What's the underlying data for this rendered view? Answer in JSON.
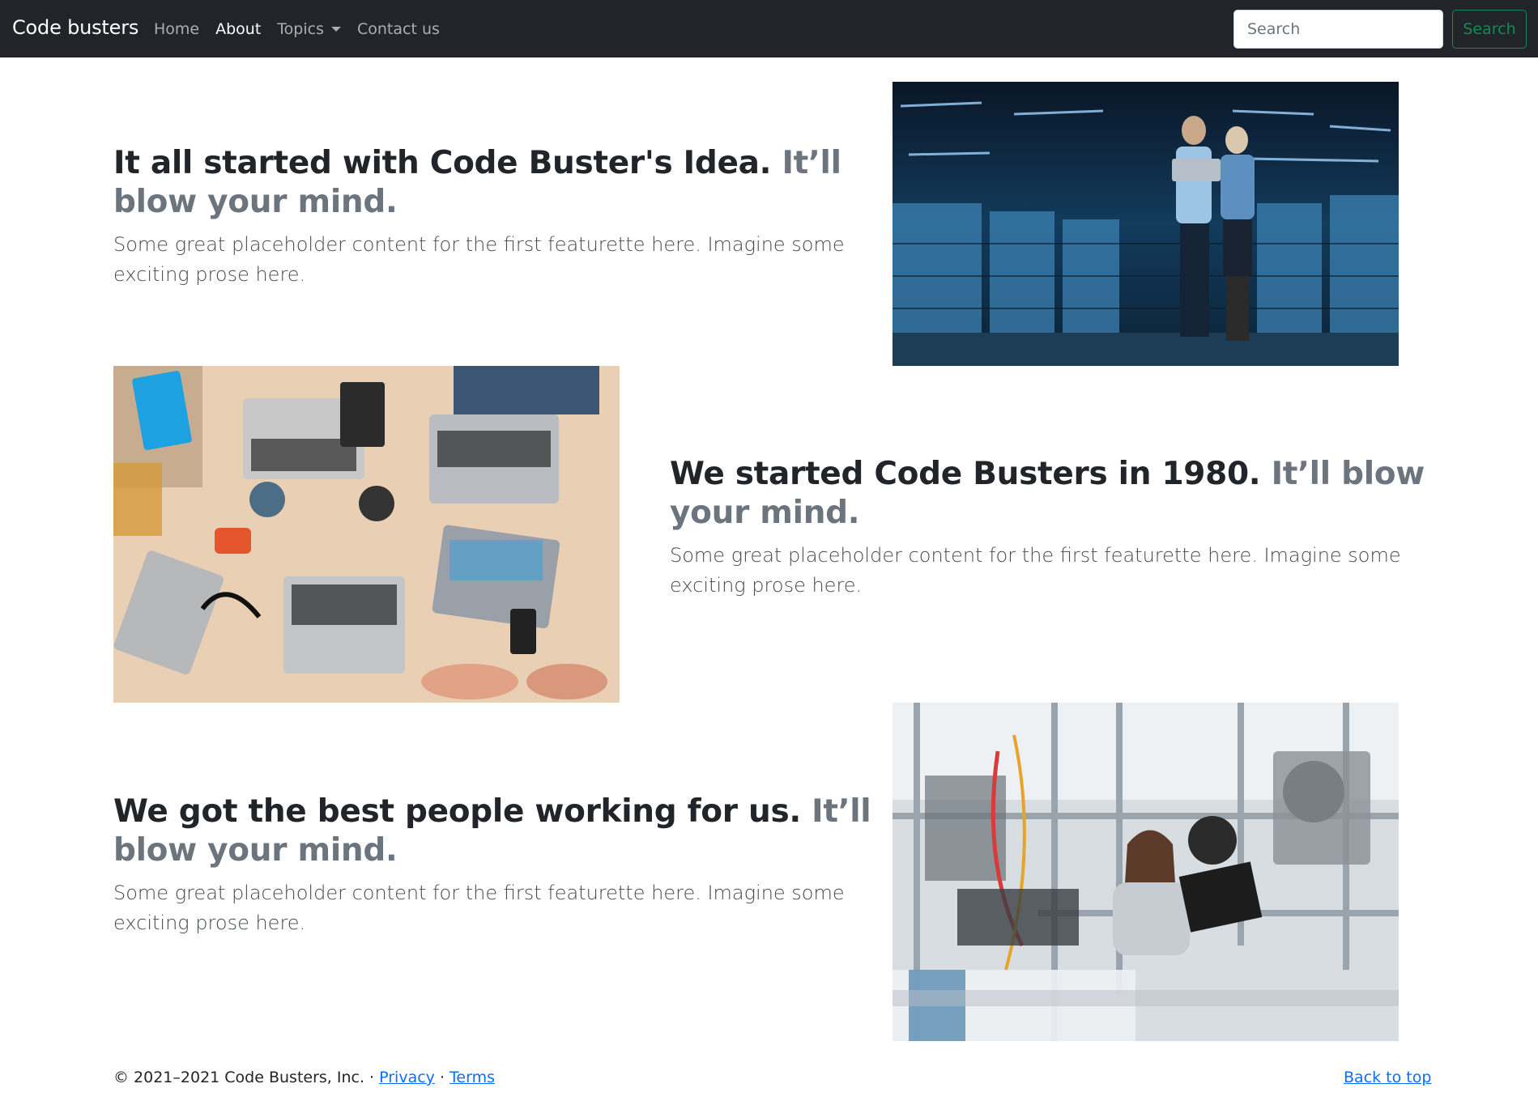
{
  "navbar": {
    "brand": "Code busters",
    "links": [
      {
        "label": "Home",
        "active": false
      },
      {
        "label": "About",
        "active": true
      },
      {
        "label": "Topics",
        "active": false,
        "dropdown": true
      },
      {
        "label": "Contact us",
        "active": false
      }
    ],
    "search": {
      "placeholder": "Search",
      "button_label": "Search"
    }
  },
  "featurettes": [
    {
      "heading": "It all started with Code Buster's Idea.",
      "heading_muted": "It’ll blow your mind.",
      "lead": "Some great placeholder content for the first featurette here. Imagine some exciting prose here."
    },
    {
      "heading": "We started Code Busters in 1980.",
      "heading_muted": "It’ll blow your mind.",
      "lead": "Some great placeholder content for the first featurette here. Imagine some exciting prose here."
    },
    {
      "heading": "We got the best people working for us.",
      "heading_muted": "It’ll blow your mind.",
      "lead": "Some great placeholder content for the first featurette here. Imagine some exciting prose here."
    }
  ],
  "footer": {
    "copyright": "© 2021–2021 Code Busters, Inc. · ",
    "privacy": "Privacy",
    "separator": " · ",
    "terms": "Terms",
    "back_to_top": "Back to top"
  },
  "colors": {
    "navbar_bg": "#212529",
    "muted": "#6c757d",
    "success": "#198754",
    "link": "#0d6efd"
  }
}
